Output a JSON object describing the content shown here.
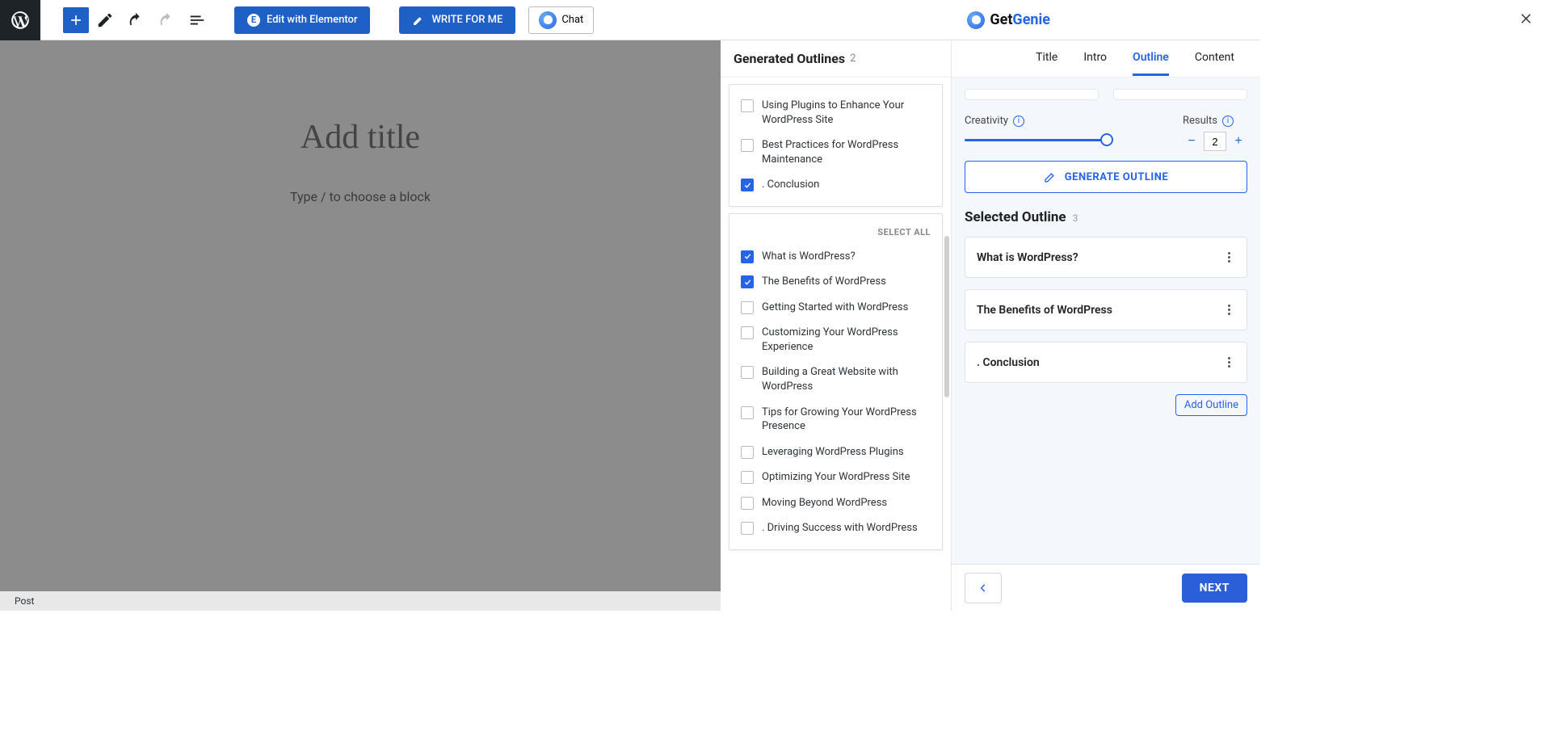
{
  "topbar": {
    "elementor_label": "Edit with Elementor",
    "write_label": "WRITE FOR ME",
    "chat_label": "Chat",
    "brand_left": "Get",
    "brand_right": "Genie"
  },
  "editor": {
    "title_placeholder": "Add title",
    "block_placeholder": "Type / to choose a block",
    "footer": "Post"
  },
  "outlines": {
    "heading": "Generated Outlines",
    "count": "2",
    "select_all": "SELECT ALL",
    "group1": [
      {
        "label": "Using Plugins to Enhance Your WordPress Site",
        "checked": false
      },
      {
        "label": "Best Practices for WordPress Maintenance",
        "checked": false
      },
      {
        "label": ". Conclusion",
        "checked": true
      }
    ],
    "group2": [
      {
        "label": "What is WordPress?",
        "checked": true
      },
      {
        "label": "The Benefits of WordPress",
        "checked": true
      },
      {
        "label": "Getting Started with WordPress",
        "checked": false
      },
      {
        "label": "Customizing Your WordPress Experience",
        "checked": false
      },
      {
        "label": "Building a Great Website with WordPress",
        "checked": false
      },
      {
        "label": "Tips for Growing Your WordPress Presence",
        "checked": false
      },
      {
        "label": "Leveraging WordPress Plugins",
        "checked": false
      },
      {
        "label": "Optimizing Your WordPress Site",
        "checked": false
      },
      {
        "label": "Moving Beyond WordPress",
        "checked": false
      },
      {
        "label": ". Driving Success with WordPress",
        "checked": false
      }
    ]
  },
  "tabs": {
    "title": "Title",
    "intro": "Intro",
    "outline": "Outline",
    "content": "Content"
  },
  "controls": {
    "creativity_label": "Creativity",
    "results_label": "Results",
    "results_value": "2",
    "generate_label": "GENERATE OUTLINE"
  },
  "selected": {
    "heading": "Selected Outline",
    "count": "3",
    "items": [
      "What is WordPress?",
      "The Benefits of WordPress",
      ". Conclusion"
    ],
    "add_label": "Add Outline"
  },
  "nav": {
    "next": "NEXT"
  }
}
